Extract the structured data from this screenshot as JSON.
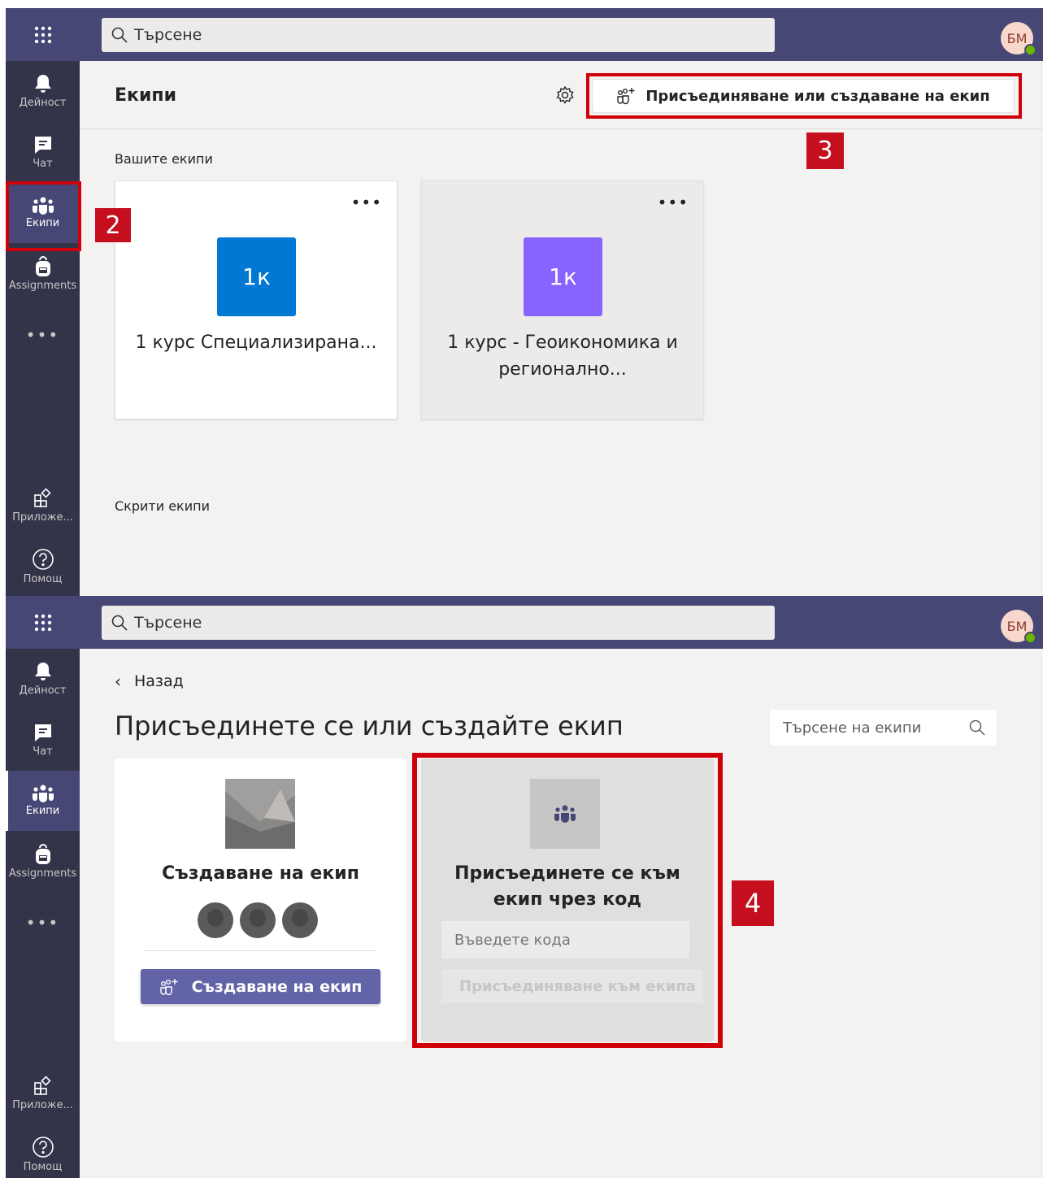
{
  "search": {
    "placeholder": "Търсене"
  },
  "user": {
    "initials": "БМ"
  },
  "rail": {
    "activity": "Дейност",
    "chat": "Чат",
    "teams": "Екипи",
    "assignments": "Assignments",
    "more": "•••",
    "apps": "Приложе...",
    "help": "Помощ"
  },
  "panel1": {
    "title": "Екипи",
    "join_create_label": "Присъединяване или създаване на екип",
    "your_teams_label": "Вашите екипи",
    "hidden_teams_label": "Скрити екипи",
    "teams": [
      {
        "initials": "1к",
        "name": "1 курс Специализирана...",
        "color": "#0078d4"
      },
      {
        "initials": "1к",
        "name": "1 курс - Геоикономика и регионално...",
        "color": "#8764ff"
      }
    ],
    "card_menu": "•••"
  },
  "panel2": {
    "back_label": "Назад",
    "heading": "Присъединете се или създайте екип",
    "team_search_placeholder": "Търсене на екипи",
    "create_card_title": "Създаване на екип",
    "create_button_label": "Създаване на екип",
    "join_card_title": "Присъединете се към екип чрез код",
    "code_placeholder": "Въведете кода",
    "join_button_label": "Присъединяване към екипа"
  },
  "callouts": {
    "step2": "2",
    "step3": "3",
    "step4": "4"
  },
  "colors": {
    "header": "#464775",
    "rail": "#33344a",
    "accent": "#6264a7",
    "callout": "#c50f1f"
  }
}
